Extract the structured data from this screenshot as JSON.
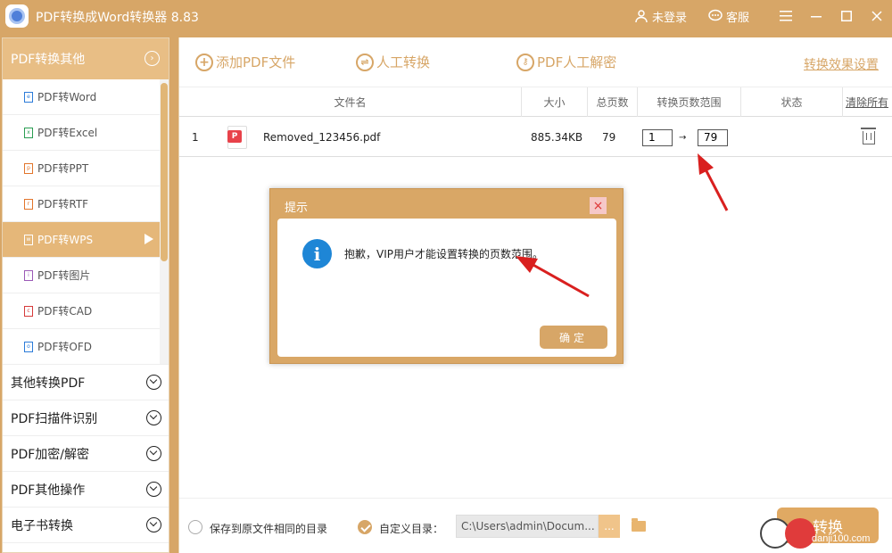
{
  "app": {
    "title": "PDF转换成Word转换器 8.83"
  },
  "titlebar": {
    "login": "未登录",
    "service": "客服"
  },
  "sidebar": {
    "header": "PDF转换其他",
    "sub_items": [
      {
        "label": "PDF转Word",
        "color": "#2b7bd9"
      },
      {
        "label": "PDF转Excel",
        "color": "#2a9d52"
      },
      {
        "label": "PDF转PPT",
        "color": "#e2752b"
      },
      {
        "label": "PDF转RTF",
        "color": "#e2752b"
      },
      {
        "label": "PDF转WPS",
        "color": "#ffffff"
      },
      {
        "label": "PDF转图片",
        "color": "#9b59b6"
      },
      {
        "label": "PDF转CAD",
        "color": "#d63a3a"
      },
      {
        "label": "PDF转OFD",
        "color": "#2b7bd9"
      }
    ],
    "categories": [
      "其他转换PDF",
      "PDF扫描件识别",
      "PDF加密/解密",
      "PDF其他操作",
      "电子书转换"
    ]
  },
  "toolbar": {
    "add_file": "添加PDF文件",
    "manual_convert": "人工转换",
    "manual_decrypt": "PDF人工解密",
    "effect_settings": "转换效果设置"
  },
  "table": {
    "headers": {
      "filename": "文件名",
      "size": "大小",
      "pages": "总页数",
      "range": "转换页数范围",
      "status": "状态",
      "clear": "清除所有"
    },
    "rows": [
      {
        "index": "1",
        "filename": "Removed_123456.pdf",
        "size": "885.34KB",
        "pages": "79",
        "from": "1",
        "to": "79",
        "arrow": "→",
        "status": ""
      }
    ]
  },
  "dialog": {
    "title": "提示",
    "close": "×",
    "message": "抱歉，VIP用户才能设置转换的页数范围。",
    "ok": "确定"
  },
  "bottom": {
    "save_same_dir": "保存到原文件相同的目录",
    "custom_dir": "自定义目录：",
    "dir_path": "C:\\Users\\admin\\Docum...",
    "browse": "...",
    "convert": "转换"
  },
  "watermark": {
    "text": "danji100.com"
  }
}
